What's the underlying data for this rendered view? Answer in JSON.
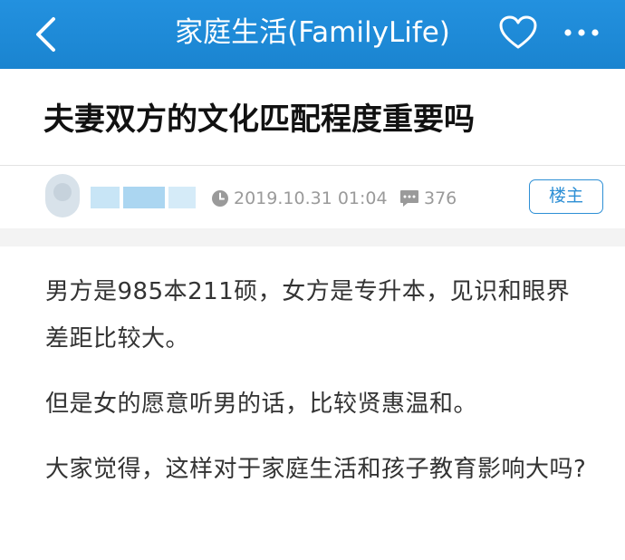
{
  "header": {
    "title": "家庭生活(FamilyLife)",
    "back_icon": "chevron-left-icon",
    "favorite_icon": "heart-outline-icon",
    "more_icon": "more-horizontal-icon",
    "background_color": "#1e8ad6"
  },
  "post": {
    "title": "夫妻双方的文化匹配程度重要吗",
    "author_avatar_icon": "avatar",
    "date": "2019.10.31 01:04",
    "comment_count": "376",
    "op_badge": "楼主",
    "paragraphs": [
      "男方是985本211硕，女方是专升本，见识和眼界差距比较大。",
      "但是女的愿意听男的话，比较贤惠温和。",
      "大家觉得，这样对于家庭生活和孩子教育影响大吗?"
    ]
  },
  "colors": {
    "accent": "#2d8fd5",
    "meta_text": "#9a9a9a",
    "body_text": "#333333"
  }
}
